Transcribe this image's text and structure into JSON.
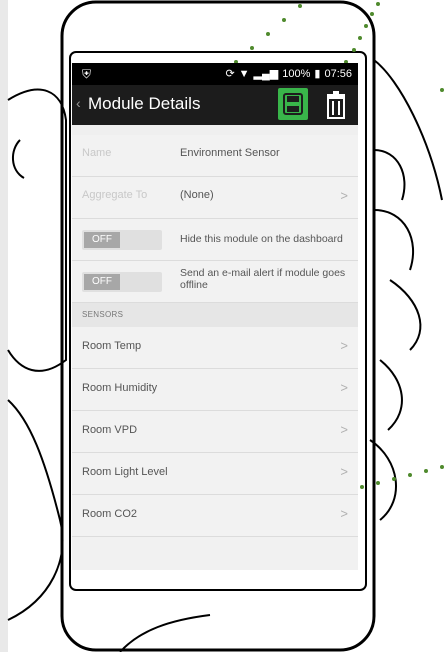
{
  "status_bar": {
    "usb_icon": "usb-icon",
    "battery": "100%",
    "time": "07:56"
  },
  "app_bar": {
    "back_icon": "chevron-left-icon",
    "title": "Module Details",
    "save_icon": "save-icon",
    "delete_icon": "trash-icon",
    "save_color": "#39B54A"
  },
  "details": {
    "name_label": "Name",
    "name_value": "Environment Sensor",
    "aggregate_label": "Aggregate To",
    "aggregate_value": "(None)",
    "chevron": ">"
  },
  "toggles": [
    {
      "state": "OFF",
      "text": "Hide this module on the dashboard"
    },
    {
      "state": "OFF",
      "text": "Send an e-mail alert if module goes offline"
    }
  ],
  "sensors_section": {
    "header": "SENSORS",
    "items": [
      {
        "name": "Room Temp"
      },
      {
        "name": "Room Humidity"
      },
      {
        "name": "Room VPD"
      },
      {
        "name": "Room Light Level"
      },
      {
        "name": "Room CO2"
      }
    ]
  },
  "colors": {
    "accent": "#39B54A",
    "dots": "#4F8A2D"
  }
}
